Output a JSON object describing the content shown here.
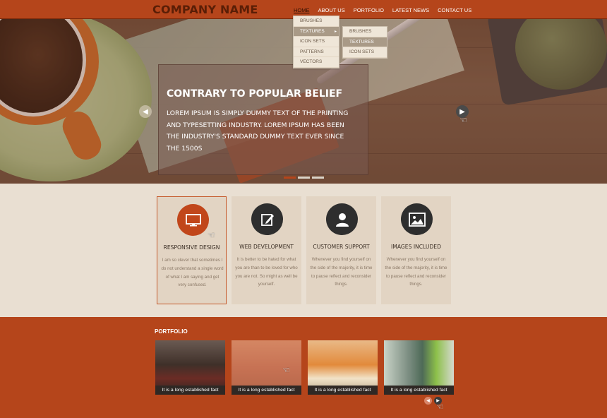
{
  "header": {
    "brand": "COMPANY NAME",
    "nav": [
      {
        "label": "HOME",
        "active": true
      },
      {
        "label": "ABOUT US"
      },
      {
        "label": "PORTFOLIO"
      },
      {
        "label": "LATEST NEWS"
      },
      {
        "label": "CONTACT US"
      }
    ],
    "dropdown": [
      "BRUSHES",
      "TEXTURES",
      "ICON SETS",
      "PATTERNS",
      "VECTORS"
    ],
    "submenu": [
      "BRUSHES",
      "TEXTURES",
      "ICON SETS"
    ],
    "dropdown_highlight": "TEXTURES",
    "submenu_highlight": "TEXTURES"
  },
  "hero": {
    "title": "CONTRARY TO POPULAR BELIEF",
    "text": "LOREM IPSUM IS SIMPLY DUMMY TEXT OF THE PRINTING AND TYPESETTING INDUSTRY. LOREM IPSUM HAS BEEN THE INDUSTRY'S STANDARD DUMMY TEXT EVER SINCE THE 1500S",
    "slides": 3,
    "active_slide": 0
  },
  "features": [
    {
      "title": "RESPONSIVE DESIGN",
      "text": "I am so clever that sometimes I do not understand a single word of what I am saying and get very confused.",
      "icon": "monitor-icon",
      "selected": true
    },
    {
      "title": "WEB DEVELOPMENT",
      "text": "It is better to be hated for what you are than to be loved for who you are not. So might as well be yourself.",
      "icon": "edit-icon"
    },
    {
      "title": "CUSTOMER SUPPORT",
      "text": "Whenever you find yourself on the side of the majority, it is time to pause reflect and reconsider things.",
      "icon": "user-icon"
    },
    {
      "title": "IMAGES INCLUDED",
      "text": "Whenever you find yourself on the side of the majority, it is time to pause reflect and reconsider things.",
      "icon": "image-icon"
    }
  ],
  "portfolio": {
    "title": "PORTFOLIO",
    "items": [
      {
        "caption": "It is a long established fact"
      },
      {
        "caption": "It is a long established fact"
      },
      {
        "caption": "It is a long established fact"
      },
      {
        "caption": "It is a long established fact"
      }
    ]
  },
  "colors": {
    "accent": "#b5451b",
    "dark": "#2e2e2e",
    "light": "#e9dfd2"
  }
}
